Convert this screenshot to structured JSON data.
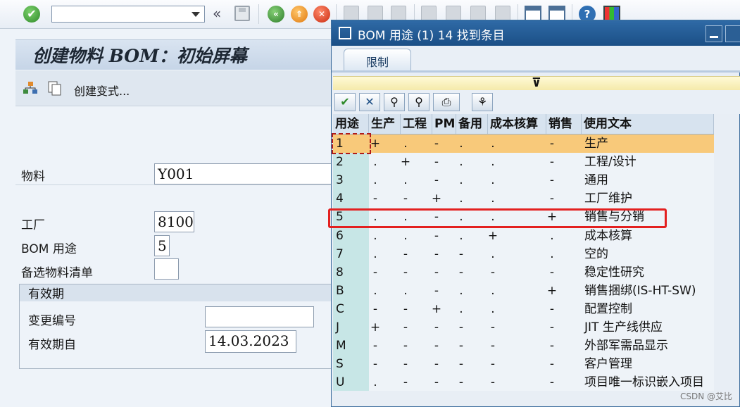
{
  "toolbar": {
    "ok_icon": "check-icon",
    "command_value": "",
    "icons": [
      "check-icon",
      "command-dropdown-icon",
      "collapse-icon",
      "save-icon",
      "back-icon",
      "exit-icon",
      "cancel-icon",
      "print-icon",
      "find-icon",
      "find-next-icon",
      "page-first-icon",
      "page-prev-icon",
      "page-next-icon",
      "page-last-icon",
      "new-session-icon",
      "shortcut-icon",
      "help-icon",
      "layout-icon"
    ]
  },
  "main": {
    "title": "创建物料 BOM：初始屏幕",
    "variant_button": "创建变式...",
    "fields": {
      "material_label": "物料",
      "material_value": "Y001",
      "plant_label": "工厂",
      "plant_value": "8100",
      "usage_label": "BOM 用途",
      "usage_value": "5",
      "alt_label": "备选物料清单",
      "alt_value": ""
    },
    "validity": {
      "title": "有效期",
      "change_no_label": "变更编号",
      "change_no_value": "",
      "valid_from_label": "有效期自",
      "valid_from_value": "14.03.2023"
    }
  },
  "popup": {
    "title": "BOM 用途 (1)   14 找到条目",
    "tab_label": "限制",
    "columns": [
      "用途",
      "生产",
      "工程",
      "PM",
      "备用",
      "成本核算",
      "销售",
      "使用文本"
    ],
    "rows": [
      {
        "key": "1",
        "prod": "+",
        "eng": ".",
        "pm": "-",
        "spare": ".",
        "cost": ".",
        "sales": "-",
        "text": "生产"
      },
      {
        "key": "2",
        "prod": ".",
        "eng": "+",
        "pm": "-",
        "spare": ".",
        "cost": ".",
        "sales": "-",
        "text": "工程/设计"
      },
      {
        "key": "3",
        "prod": ".",
        "eng": ".",
        "pm": "-",
        "spare": ".",
        "cost": ".",
        "sales": "-",
        "text": "通用"
      },
      {
        "key": "4",
        "prod": "-",
        "eng": "-",
        "pm": "+",
        "spare": ".",
        "cost": ".",
        "sales": "-",
        "text": "工厂维护"
      },
      {
        "key": "5",
        "prod": ".",
        "eng": ".",
        "pm": "-",
        "spare": ".",
        "cost": ".",
        "sales": "+",
        "text": "销售与分销"
      },
      {
        "key": "6",
        "prod": ".",
        "eng": ".",
        "pm": "-",
        "spare": ".",
        "cost": "+",
        "sales": ".",
        "text": "成本核算"
      },
      {
        "key": "7",
        "prod": ".",
        "eng": "-",
        "pm": "-",
        "spare": "-",
        "cost": ".",
        "sales": ".",
        "text": "空的"
      },
      {
        "key": "8",
        "prod": "-",
        "eng": "-",
        "pm": "-",
        "spare": "-",
        "cost": "-",
        "sales": "-",
        "text": "稳定性研究"
      },
      {
        "key": "B",
        "prod": ".",
        "eng": ".",
        "pm": "-",
        "spare": ".",
        "cost": ".",
        "sales": "+",
        "text": "销售捆绑(IS-HT-SW)"
      },
      {
        "key": "C",
        "prod": "-",
        "eng": "-",
        "pm": "+",
        "spare": ".",
        "cost": ".",
        "sales": "-",
        "text": "配置控制"
      },
      {
        "key": "J",
        "prod": "+",
        "eng": "-",
        "pm": "-",
        "spare": "-",
        "cost": "-",
        "sales": "-",
        "text": "JIT 生产线供应"
      },
      {
        "key": "M",
        "prod": "-",
        "eng": "-",
        "pm": "-",
        "spare": "-",
        "cost": "-",
        "sales": "-",
        "text": "外部军需品显示"
      },
      {
        "key": "S",
        "prod": "-",
        "eng": "-",
        "pm": "-",
        "spare": "-",
        "cost": "-",
        "sales": "-",
        "text": "客户管理"
      },
      {
        "key": "U",
        "prod": ".",
        "eng": "-",
        "pm": "-",
        "spare": "-",
        "cost": "-",
        "sales": "-",
        "text": "项目唯一标识嵌入项目"
      }
    ],
    "selected_row": "1",
    "highlighted_row": "5",
    "highlight_color": "#f8c97a",
    "annotation_color": "#e32020"
  },
  "watermark": "CSDN @艾比"
}
